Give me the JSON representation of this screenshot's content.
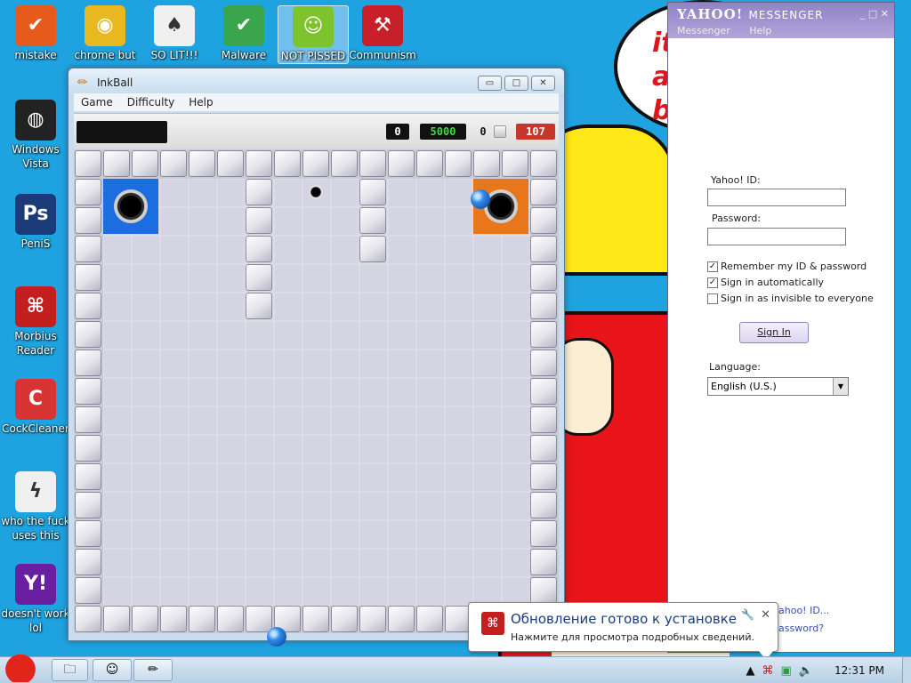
{
  "desktop": {
    "icons": [
      {
        "label": "mistake",
        "color": "#e65a1b",
        "glyph": "✔"
      },
      {
        "label": "chrome but",
        "color": "#e8b820",
        "glyph": "◉"
      },
      {
        "label": "SO LIT!!!",
        "color": "#f0f0f0",
        "glyph": "♠"
      },
      {
        "label": "Malware",
        "color": "#3aa54a",
        "glyph": "✔"
      },
      {
        "label": "NOT PISSED",
        "color": "#7cc32c",
        "glyph": "☺"
      },
      {
        "label": "Communism",
        "color": "#c8202a",
        "glyph": "⚒"
      },
      {
        "label": "Windows Vista",
        "color": "#222222",
        "glyph": "◍"
      },
      {
        "label": "PeniS",
        "color": "#1b3a7a",
        "glyph": "Ps"
      },
      {
        "label": "Morbius Reader",
        "color": "#c41f1f",
        "glyph": "⌘"
      },
      {
        "label": "CockCleaner",
        "color": "#d73434",
        "glyph": "C"
      },
      {
        "label": "who the fuck uses this",
        "color": "#f0f0f0",
        "glyph": "ϟ"
      },
      {
        "label": "doesn't work lol",
        "color": "#6a1fa0",
        "glyph": "Y!"
      }
    ]
  },
  "wallpaper": {
    "text": "it\na\nb"
  },
  "inkball": {
    "title": "InkBall",
    "menus": [
      "Game",
      "Difficulty",
      "Help"
    ],
    "score": "0",
    "bonus": "5000",
    "balls_left": "0",
    "time": "107",
    "controls": {
      "minimize": "▭",
      "maximize": "□",
      "close": "✕"
    }
  },
  "yahoo": {
    "title": "YAHOO!",
    "title_suffix": "MESSENGER",
    "menus": [
      "Messenger",
      "Help"
    ],
    "window_controls": "_ □ ✕",
    "id_label": "Yahoo! ID:",
    "id_value": "",
    "password_label": "Password:",
    "password_value": "",
    "remember_label": "Remember my ID & password",
    "remember_checked": true,
    "auto_label": "Sign in automatically",
    "auto_checked": true,
    "invisible_label": "Sign in as invisible to everyone",
    "invisible_checked": false,
    "signin_label": "Sign In",
    "language_label": "Language:",
    "language_value": "English (U.S.)",
    "link_id": "ahoo! ID...",
    "link_password": "assword?"
  },
  "balloon": {
    "title": "Обновление готово к установке",
    "body": "Нажмите для просмотра подробных сведений."
  },
  "taskbar": {
    "clock": "12:31 PM"
  },
  "colors": {
    "desktop_bg": "#1fa3e0",
    "hole_blue": "#1c6de0",
    "hole_orange": "#e8771c",
    "timer_red": "#c4372a",
    "bonus_green": "#45d845"
  }
}
